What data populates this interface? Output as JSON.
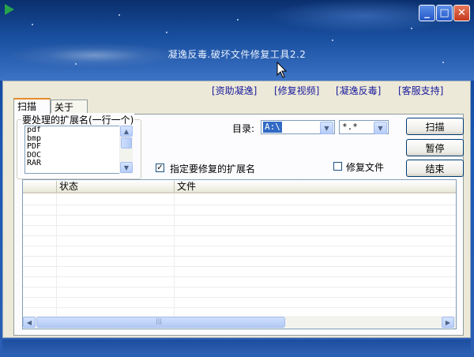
{
  "window": {
    "app_title": "凝逸反毒.破坏文件修复工具2.2",
    "buttons": {
      "minimize": "_",
      "maximize": "□",
      "close": "✕"
    }
  },
  "nav_links": [
    "[资助凝逸]",
    "[修复视频]",
    "[凝逸反毒]",
    "[客服支持]"
  ],
  "tabs": [
    "扫描",
    "关于"
  ],
  "extensions": {
    "group_title": "要处理的扩展名(一行一个)",
    "items": [
      "pdf",
      "bmp",
      "PDF",
      "DOC",
      "RAR"
    ]
  },
  "directory": {
    "label": "目录:",
    "value": "A:\\"
  },
  "filter": {
    "value": "*.*"
  },
  "actions": {
    "scan": "扫描",
    "pause": "暂停",
    "end": "结束"
  },
  "options": {
    "specify_ext": {
      "label": "指定要修复的扩展名",
      "checked": true,
      "mark": "✓"
    },
    "repair_file": {
      "label": "修复文件",
      "checked": false,
      "mark": ""
    }
  },
  "table": {
    "columns": [
      "",
      "状态",
      "文件"
    ],
    "rows": []
  },
  "scrollbar": {
    "grip": "|||",
    "left_arrow": "◀",
    "right_arrow": "▶",
    "up_arrow": "▲",
    "down_arrow": "▼"
  },
  "colors": {
    "accent": "#316ac5",
    "link": "#1a1a9c",
    "title_bar": "#0f3a86"
  }
}
